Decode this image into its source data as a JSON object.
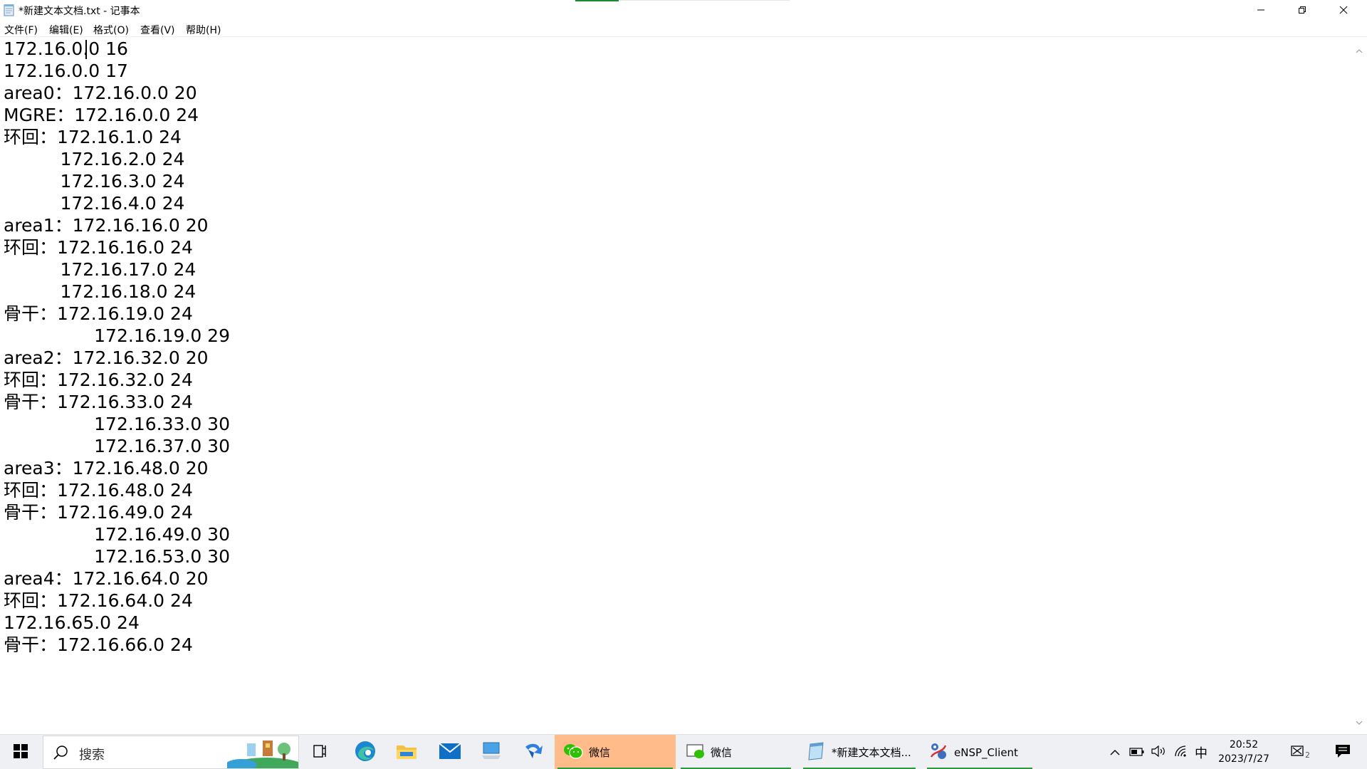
{
  "window": {
    "title": "*新建文本文档.txt - 记事本",
    "accent_color": "#1e8a2e",
    "controls": {
      "minimize": "minimize-icon",
      "maximize": "restore-icon",
      "close": "close-icon"
    }
  },
  "menu": {
    "items": [
      {
        "label": "文件(F)"
      },
      {
        "label": "编辑(E)"
      },
      {
        "label": "格式(O)"
      },
      {
        "label": "查看(V)"
      },
      {
        "label": "帮助(H)"
      }
    ]
  },
  "editor": {
    "lines": [
      "172.16.0.0 16",
      "172.16.0.0 17",
      "area0：172.16.0.0 20",
      "MGRE：172.16.0.0 24",
      "环回：172.16.1.0 24",
      "          172.16.2.0 24",
      "          172.16.3.0 24",
      "          172.16.4.0 24",
      "area1：172.16.16.0 20",
      "环回：172.16.16.0 24",
      "          172.16.17.0 24",
      "          172.16.18.0 24",
      "骨干：172.16.19.0 24",
      "                172.16.19.0 29",
      "area2：172.16.32.0 20",
      "环回：172.16.32.0 24",
      "骨干：172.16.33.0 24",
      "                172.16.33.0 30",
      "                172.16.37.0 30",
      "area3：172.16.48.0 20",
      "环回：172.16.48.0 24",
      "骨干：172.16.49.0 24",
      "                172.16.49.0 30",
      "                172.16.53.0 30",
      "area4：172.16.64.0 20",
      "环回：172.16.64.0 24",
      "172.16.65.0 24",
      "骨干：172.16.66.0 24"
    ]
  },
  "taskbar": {
    "search_placeholder": "搜索",
    "apps": [
      {
        "label": "微信",
        "state": "active",
        "color": "#ffbb8a"
      },
      {
        "label": "微信",
        "state": "running"
      },
      {
        "label": "*新建文本文档...",
        "state": "running"
      },
      {
        "label": "eNSP_Client",
        "state": "running"
      }
    ],
    "tray": {
      "ime": "中",
      "time": "20:52",
      "date": "2023/7/27",
      "notification_count": "2"
    }
  }
}
